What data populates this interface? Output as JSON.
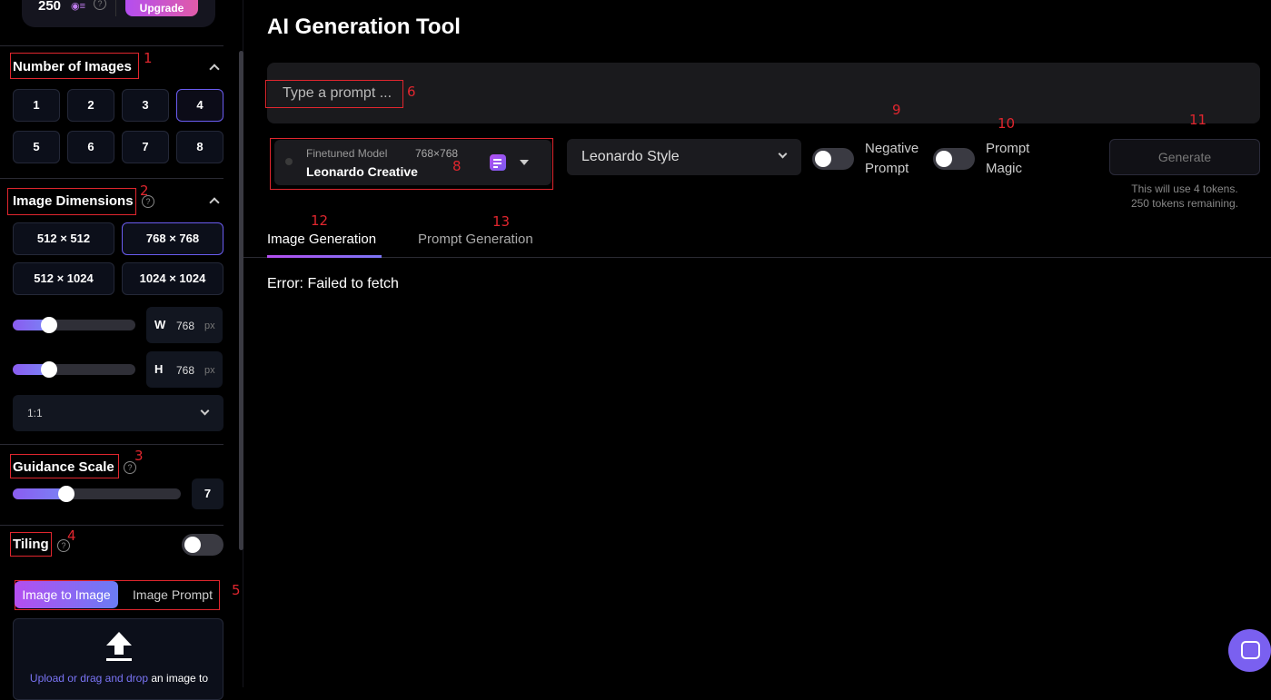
{
  "sidebar": {
    "tokens": {
      "count": "250",
      "upgrade_label": "Upgrade",
      "help": "?"
    },
    "number_of_images": {
      "title": "Number of Images",
      "options": [
        "1",
        "2",
        "3",
        "4",
        "5",
        "6",
        "7",
        "8"
      ],
      "selected": "4",
      "annotation": "1"
    },
    "image_dimensions": {
      "title": "Image Dimensions",
      "help": "?",
      "annotation": "2",
      "presets": [
        "512 × 512",
        "768 × 768",
        "512 × 1024",
        "1024 × 1024"
      ],
      "selected": "768 × 768",
      "width": {
        "label": "W",
        "value": "768",
        "unit": "px",
        "slider_fraction": 0.3
      },
      "height": {
        "label": "H",
        "value": "768",
        "unit": "px",
        "slider_fraction": 0.3
      },
      "aspect_ratio": "1:1"
    },
    "guidance_scale": {
      "title": "Guidance Scale",
      "help": "?",
      "value": "7",
      "annotation": "3",
      "slider_fraction": 0.3
    },
    "tiling": {
      "title": "Tiling",
      "help": "?",
      "annotation": "4",
      "enabled": false
    },
    "image_tabs": {
      "tab_a": "Image to Image",
      "tab_b": "Image Prompt",
      "annotation": "5"
    },
    "upload": {
      "link": "Upload or drag and drop",
      "text": " an image to"
    }
  },
  "main": {
    "title": "AI Generation Tool",
    "prompt": {
      "placeholder": "Type a prompt ...",
      "annotation": "6"
    },
    "model": {
      "small": "Finetuned Model",
      "dims": "768×768",
      "name": "Leonardo Creative",
      "annotation": "8"
    },
    "style": {
      "value": "Leonardo Style"
    },
    "negative_prompt": {
      "label_1": "Negative",
      "label_2": "Prompt",
      "annotation": "9",
      "enabled": false
    },
    "prompt_magic": {
      "label_1": "Prompt",
      "label_2": "Magic",
      "annotation": "10",
      "enabled": false
    },
    "generate": {
      "label": "Generate",
      "annotation": "11",
      "note_1": "This will use 4 tokens.",
      "note_2": "250 tokens remaining."
    },
    "tabs": [
      {
        "label": "Image Generation",
        "annotation": "12",
        "active": true
      },
      {
        "label": "Prompt Generation",
        "annotation": "13",
        "active": false
      }
    ],
    "error": "Error: Failed to fetch"
  },
  "colors": {
    "accent": "#7a60f0",
    "annotation_red": "#e0262e",
    "background": "#000000"
  }
}
